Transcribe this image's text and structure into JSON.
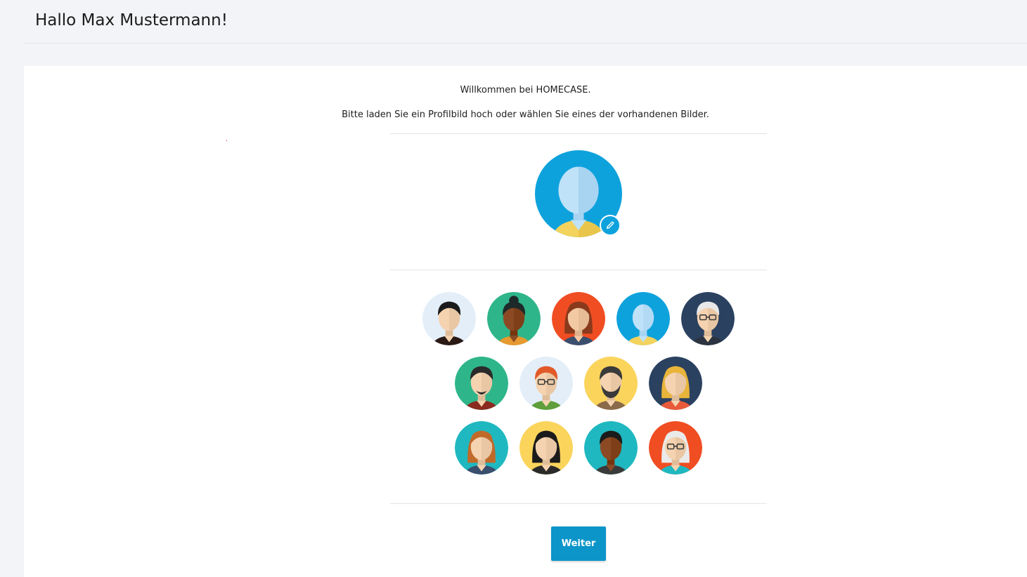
{
  "header": {
    "title": "Hallo Max Mustermann!"
  },
  "welcome": {
    "line1": "Willkommen bei HOMECASE.",
    "line2": "Bitte laden Sie ein Profilbild hoch oder wählen Sie eines der vorhandenen Bilder."
  },
  "current_avatar": {
    "icon": "default-avatar",
    "edit_icon": "pencil-icon",
    "bg": "#0ea2dd"
  },
  "avatar_rows": [
    [
      {
        "id": "avatar-man-black-hair",
        "bg": "#e3eef8",
        "hair": "#1b1b1b",
        "skin": "#f5d3b0",
        "shirt": "#2a1a16",
        "style": "short"
      },
      {
        "id": "avatar-woman-dark-skin-bun",
        "bg": "#2fb58a",
        "hair": "#1e2a2a",
        "skin": "#8b4a24",
        "shirt": "#e69a2f",
        "style": "bun"
      },
      {
        "id": "avatar-woman-red-bg",
        "bg": "#f04d23",
        "hair": "#8a3a1c",
        "skin": "#f3c9a4",
        "shirt": "#3a4e6e",
        "style": "long"
      },
      {
        "id": "avatar-default-blue",
        "bg": "#0ea2dd",
        "hair": "#0ea2dd",
        "skin": "#bfe2f8",
        "shirt": "#f3d35d",
        "style": "default"
      },
      {
        "id": "avatar-old-man-glasses",
        "bg": "#2b4160",
        "hair": "#e8e8e8",
        "skin": "#f5d3b0",
        "shirt": "#2b3440",
        "style": "oldglasses"
      }
    ],
    [
      {
        "id": "avatar-man-goatee",
        "bg": "#2fb58a",
        "hair": "#2a2a2a",
        "skin": "#f5d3b0",
        "shirt": "#8b2a1f",
        "style": "goatee"
      },
      {
        "id": "avatar-man-redhead-glasses",
        "bg": "#e3eef8",
        "hair": "#e25a2a",
        "skin": "#f5d3b0",
        "shirt": "#5e9e3b",
        "style": "glasses"
      },
      {
        "id": "avatar-man-beard",
        "bg": "#fbd45c",
        "hair": "#3a3a3a",
        "skin": "#f5d3b0",
        "shirt": "#8a6a4a",
        "style": "beard"
      },
      {
        "id": "avatar-woman-blonde",
        "bg": "#2b4160",
        "hair": "#e8b43a",
        "skin": "#f5d3b0",
        "shirt": "#e85a3a",
        "style": "long"
      }
    ],
    [
      {
        "id": "avatar-woman-auburn",
        "bg": "#1fb8c0",
        "hair": "#c06a2a",
        "skin": "#f5d3b0",
        "shirt": "#3a4e6e",
        "style": "long"
      },
      {
        "id": "avatar-woman-black-hair",
        "bg": "#fbd45c",
        "hair": "#1b1b1b",
        "skin": "#f5d3b0",
        "shirt": "#2a2a2a",
        "style": "long"
      },
      {
        "id": "avatar-man-dark-skin",
        "bg": "#1fb8c0",
        "hair": "#1b1b1b",
        "skin": "#8b4a24",
        "shirt": "#3a3a3a",
        "style": "short"
      },
      {
        "id": "avatar-old-woman-glasses",
        "bg": "#f04d23",
        "hair": "#eaeaea",
        "skin": "#f5d3b0",
        "shirt": "#1fb8c0",
        "style": "oldwoman"
      }
    ]
  ],
  "button": {
    "label": "Weiter",
    "color": "#0c95c9"
  }
}
